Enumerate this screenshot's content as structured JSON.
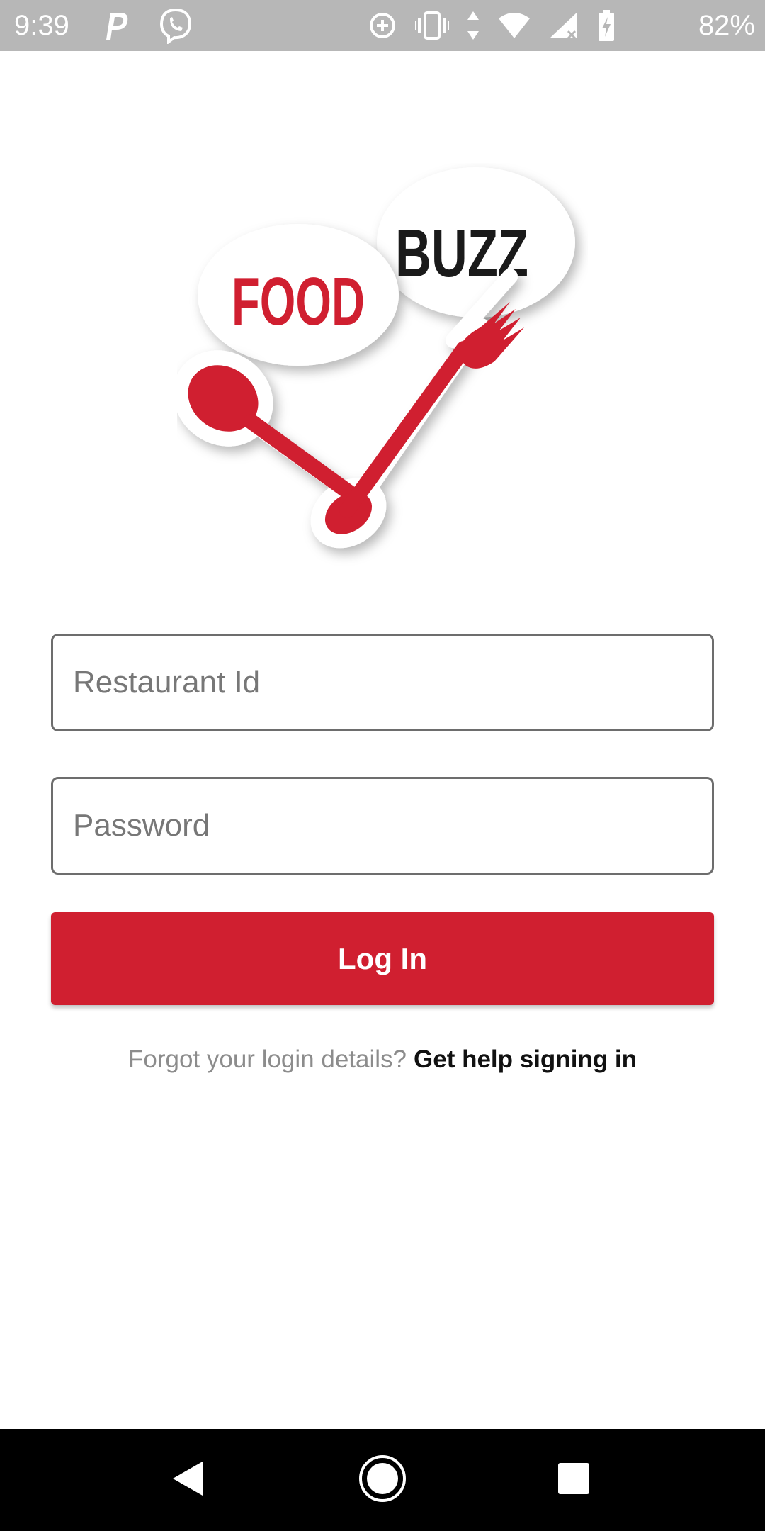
{
  "status_bar": {
    "time": "9:39",
    "battery_percent": "82%",
    "left_icons": [
      "parking-icon",
      "viber-icon"
    ],
    "right_icons": [
      "data-saver-icon",
      "vibrate-icon",
      "data-arrows-icon",
      "wifi-icon",
      "signal-icon",
      "battery-charging-icon"
    ]
  },
  "logo": {
    "word_food": "FOOD",
    "word_buzz": "BUZZ",
    "colors": {
      "red": "#d01f30",
      "dark": "#1a1a1a"
    }
  },
  "form": {
    "restaurant_id": {
      "placeholder": "Restaurant Id",
      "value": ""
    },
    "password": {
      "placeholder": "Password",
      "value": ""
    },
    "login_label": "Log In"
  },
  "help": {
    "prompt": "Forgot your login details?",
    "link": "Get help signing in"
  },
  "nav_bar": {
    "buttons": [
      "back-icon",
      "home-icon",
      "recents-icon"
    ]
  },
  "colors": {
    "accent": "#d01f30",
    "status_bar_bg": "#b7b7b7",
    "nav_bar_bg": "#000000"
  }
}
